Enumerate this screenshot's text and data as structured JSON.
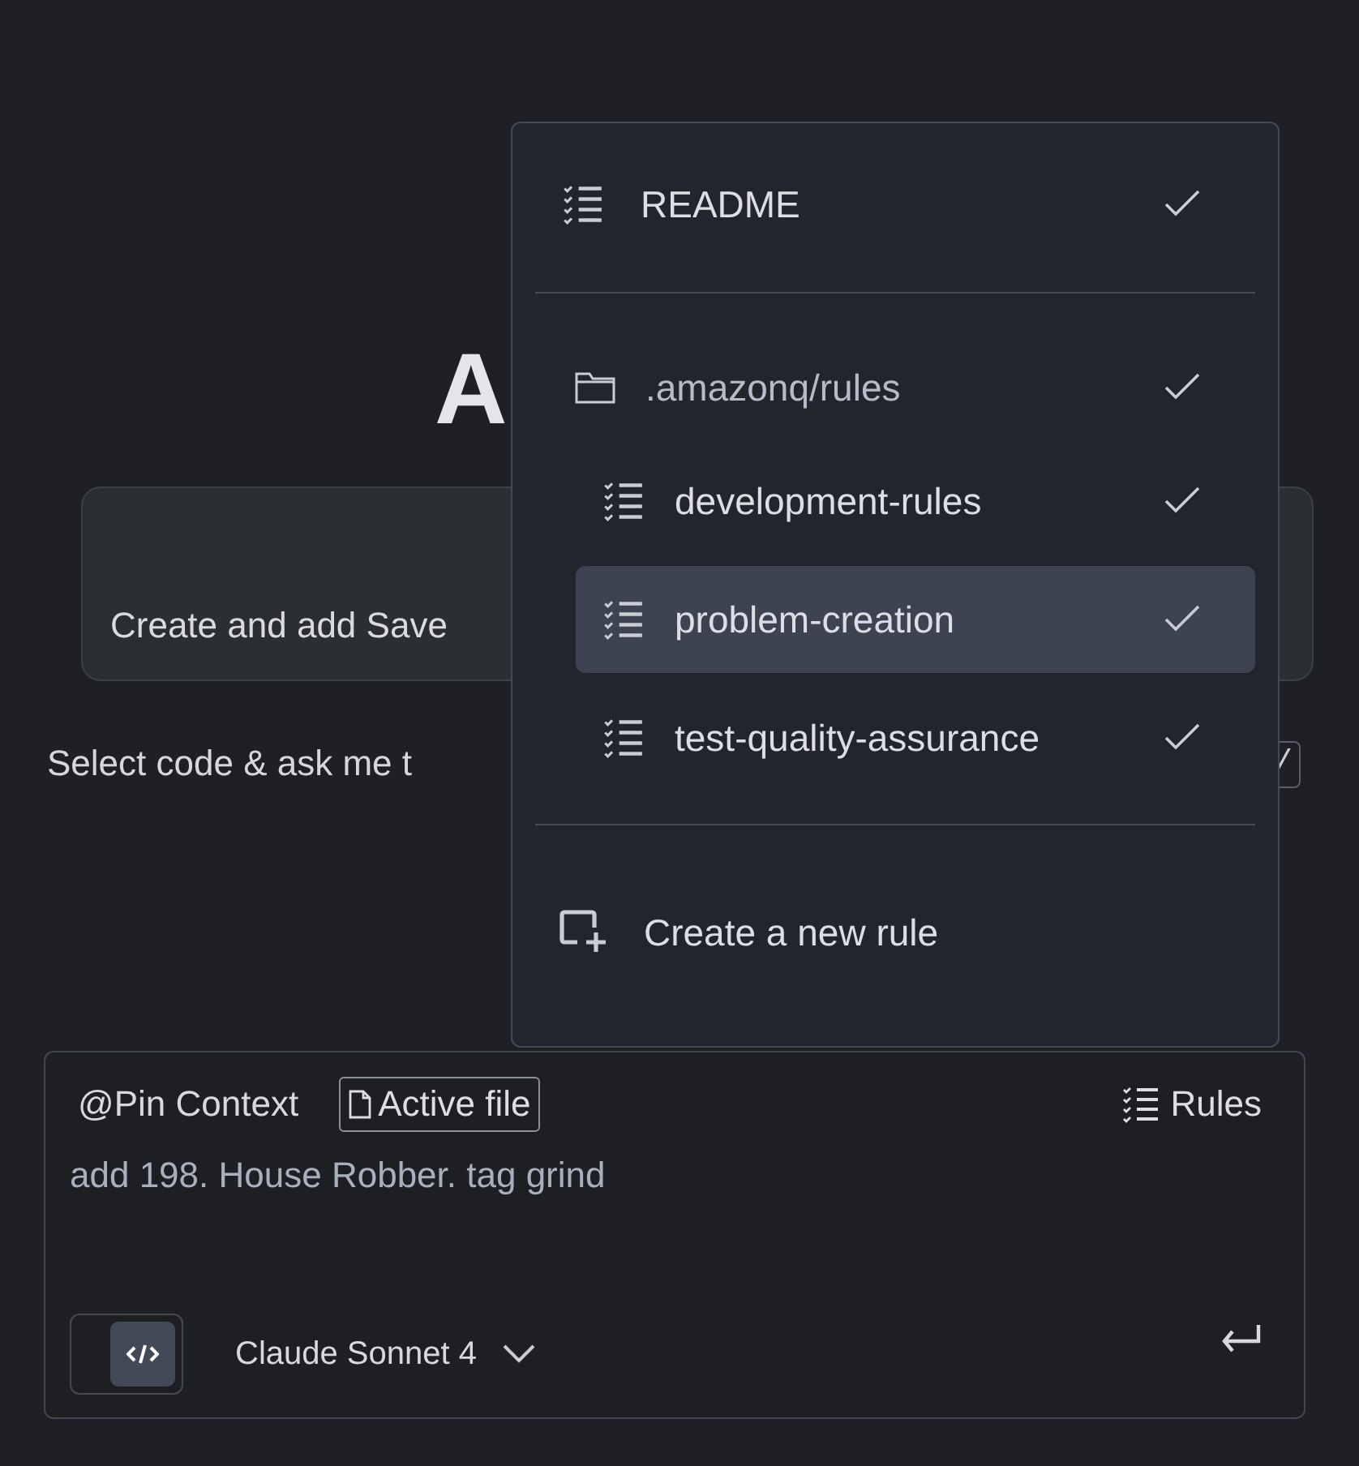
{
  "background": {
    "heading": "A",
    "card_text": "Create and add Save",
    "hint": "Select code & ask me t",
    "shortcut_key": "/"
  },
  "rules_menu": {
    "items": [
      {
        "kind": "rule",
        "label": "README",
        "checked": true,
        "selected": false
      },
      {
        "kind": "folder",
        "label": ".amazonq/rules",
        "checked": true,
        "selected": false,
        "children": [
          {
            "kind": "rule",
            "label": "development-rules",
            "checked": true,
            "selected": false
          },
          {
            "kind": "rule",
            "label": "problem-creation",
            "checked": true,
            "selected": true
          },
          {
            "kind": "rule",
            "label": "test-quality-assurance",
            "checked": true,
            "selected": false
          }
        ]
      }
    ],
    "action": {
      "label": "Create a new rule"
    }
  },
  "prompt": {
    "pin_context": "@Pin Context",
    "active_file": "Active file",
    "rules_button": "Rules",
    "value": "add 198. House Robber. tag grind",
    "code_toggle_on": true,
    "model": "Claude Sonnet 4"
  }
}
